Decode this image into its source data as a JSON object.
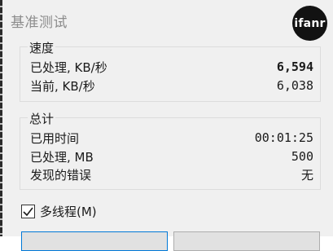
{
  "window": {
    "title": "基准测试",
    "logo_text": "ifanr"
  },
  "speed": {
    "legend": "速度",
    "rows": [
      {
        "label": "已处理, KB/秒",
        "value": "6,594"
      },
      {
        "label": "当前, KB/秒",
        "value": "6,038"
      }
    ]
  },
  "total": {
    "legend": "总计",
    "rows": [
      {
        "label": "已用时间",
        "value": "00:01:25"
      },
      {
        "label": "已处理, MB",
        "value": "500"
      },
      {
        "label": "发现的错误",
        "value": "无"
      }
    ]
  },
  "multithread": {
    "label": "多线程(M)",
    "checked": true
  },
  "colors": {
    "logo_bg": "#121212",
    "window_bg": "#f0f0f0",
    "button_focus": "#0078d7"
  }
}
